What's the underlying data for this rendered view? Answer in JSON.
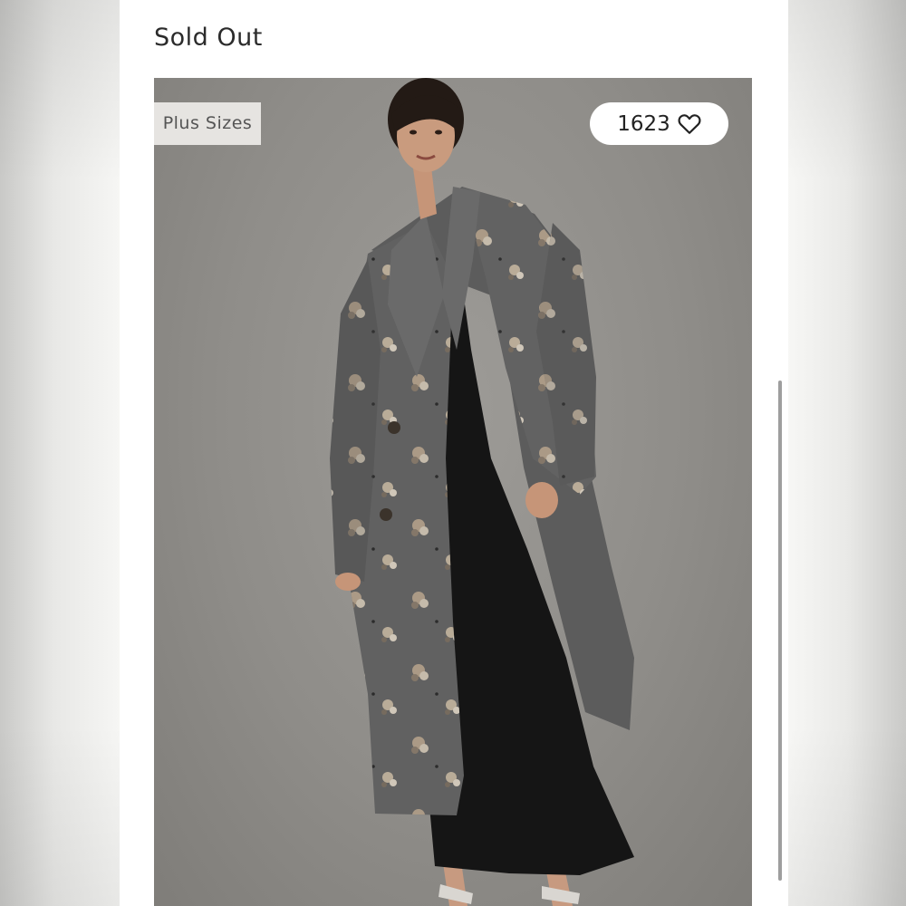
{
  "header": {
    "status_text": "Sold Out"
  },
  "product_image": {
    "badge_label": "Plus Sizes",
    "like_count": "1623",
    "like_icon": "heart-outline-icon"
  },
  "colors": {
    "backdrop": "#8f8d89",
    "coat": "#5a5a5a",
    "dress": "#151515"
  }
}
